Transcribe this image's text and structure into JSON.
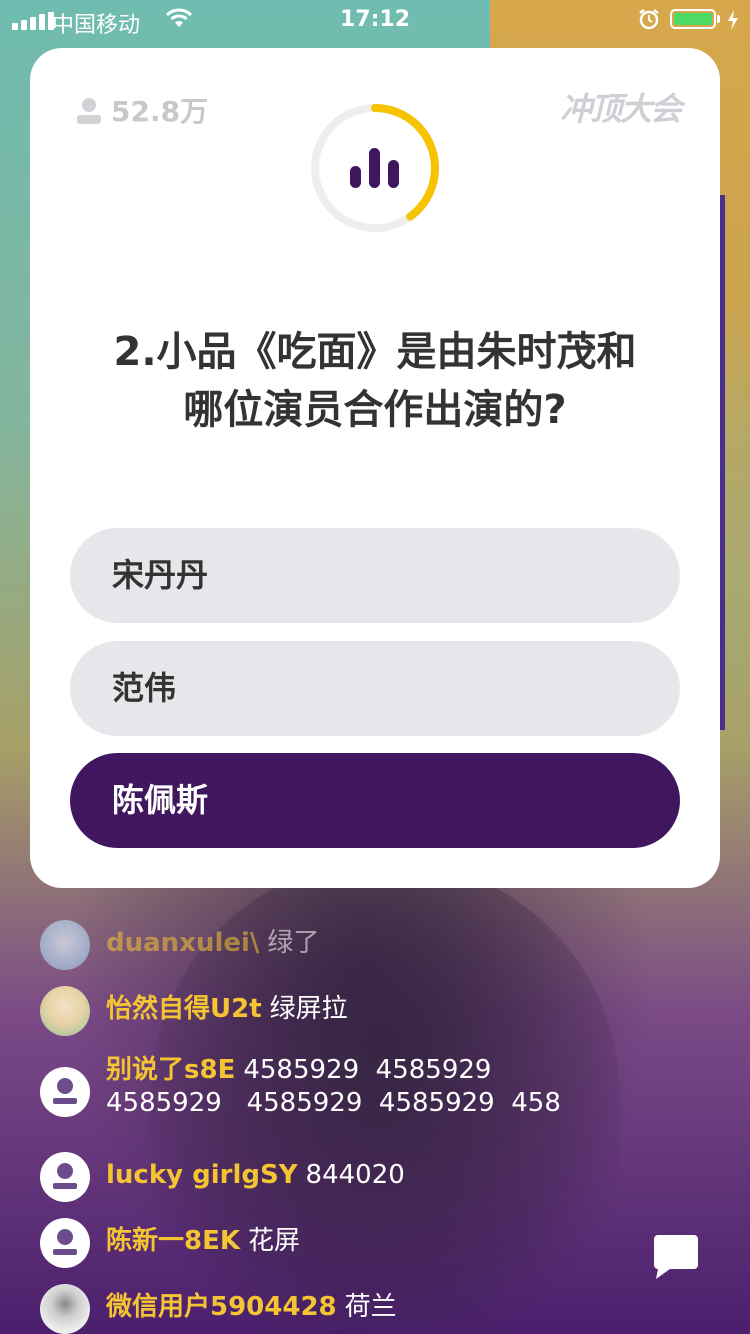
{
  "status_bar": {
    "carrier": "中国移动",
    "time": "17:12"
  },
  "quiz": {
    "viewer_count": "52.8万",
    "brand": "冲顶大会",
    "question_line1": "2.小品《吃面》是由朱时茂和",
    "question_line2": "哪位演员合作出演的?",
    "timer_progress": 0.4,
    "options": [
      {
        "label": "宋丹丹",
        "selected": false
      },
      {
        "label": "范伟",
        "selected": false
      },
      {
        "label": "陈佩斯",
        "selected": true
      }
    ]
  },
  "colors": {
    "accent_purple": "#40175e",
    "timer_yellow": "#f5c300",
    "username_yellow": "#f5c432"
  },
  "comments": [
    {
      "user": "duanxulei\\",
      "text": "绿了",
      "avatar": "snow-avatar"
    },
    {
      "user": "怡然自得U2t",
      "text": "绿屏拉",
      "avatar": "cartoon-avatar"
    },
    {
      "user": "别说了s8E",
      "text": "4585929  4585929",
      "text2": "4585929   4585929  4585929  458",
      "avatar": "default-avatar"
    },
    {
      "user": "lucky girlgSY",
      "text": "844020",
      "avatar": "default-avatar"
    },
    {
      "user": "陈新一8EK",
      "text": "花屏",
      "avatar": "default-avatar"
    },
    {
      "user": "微信用户5904428",
      "text": "荷兰",
      "avatar": "photo-avatar"
    }
  ]
}
